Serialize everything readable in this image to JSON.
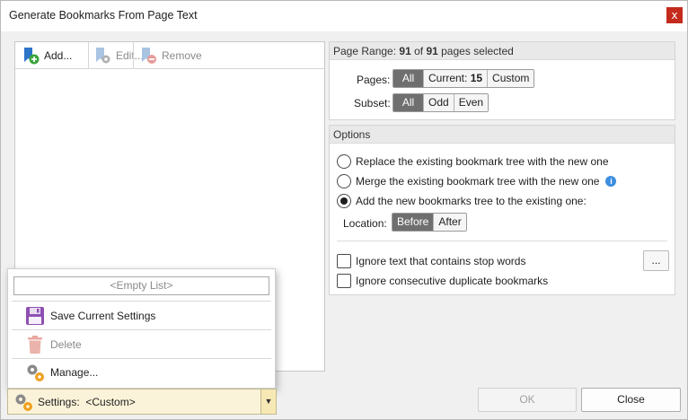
{
  "window": {
    "title": "Generate Bookmarks From Page Text",
    "close_glyph": "x"
  },
  "toolbar": {
    "add_label": "Add...",
    "edit_label": "Edit...",
    "remove_label": "Remove",
    "icons": {
      "add": "bookmark-add-icon",
      "edit": "bookmark-edit-icon",
      "remove": "bookmark-remove-icon"
    }
  },
  "page_range": {
    "prefix": "Page Range: ",
    "count": "91",
    "of": " of ",
    "total": "91",
    "suffix": " pages selected",
    "pages_label": "Pages:",
    "pages_options": {
      "all": "All",
      "current_prefix": "Current: ",
      "current_value": "15",
      "custom": "Custom"
    },
    "pages_selected": "All",
    "subset_label": "Subset:",
    "subset_options": [
      "All",
      "Odd",
      "Even"
    ],
    "subset_selected": "All"
  },
  "options": {
    "header": "Options",
    "radio_replace": "Replace the existing bookmark tree with the new one",
    "radio_merge": "Merge the existing bookmark tree with the new one",
    "radio_add": "Add the new bookmarks tree to the existing one:",
    "selected_radio": "add",
    "location_label": "Location:",
    "location_options": [
      "Before",
      "After"
    ],
    "location_selected": "Before",
    "check_stop_words": "Ignore text that contains stop words",
    "check_duplicates": "Ignore consecutive duplicate bookmarks",
    "stop_words_checked": false,
    "duplicates_checked": false,
    "ellipsis_label": "..."
  },
  "settings_menu": {
    "empty_list": "<Empty List>",
    "save_label": "Save Current Settings",
    "delete_label": "Delete",
    "manage_label": "Manage..."
  },
  "settings_combo": {
    "label": "Settings:",
    "value": "<Custom>",
    "arrow": "▼"
  },
  "footer": {
    "ok_label": "OK",
    "close_label": "Close"
  },
  "colors": {
    "accent_selected": "#6f6f6f",
    "info": "#3c8ee0",
    "close_red": "#c42b1c",
    "settings_bg": "#fbf3d9"
  }
}
